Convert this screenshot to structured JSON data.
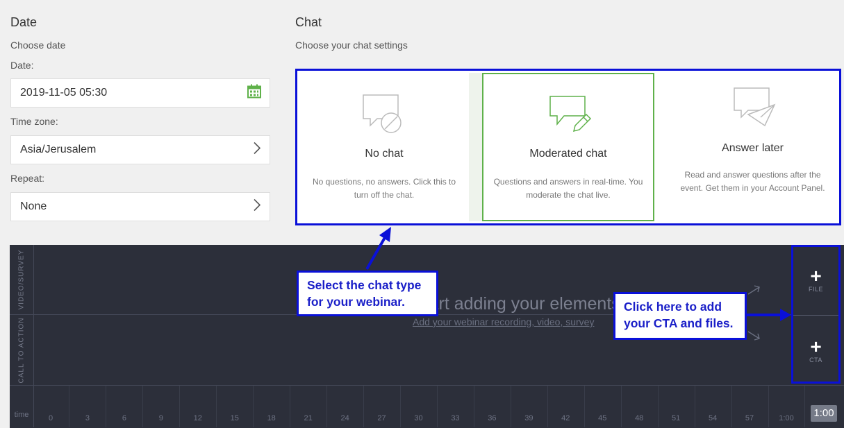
{
  "date_section": {
    "title": "Date",
    "subtitle": "Choose date",
    "date_label": "Date:",
    "date_value": "2019-11-05 05:30",
    "timezone_label": "Time zone:",
    "timezone_value": "Asia/Jerusalem",
    "repeat_label": "Repeat:",
    "repeat_value": "None"
  },
  "chat_section": {
    "title": "Chat",
    "subtitle": "Choose your chat settings",
    "options": [
      {
        "title": "No chat",
        "description": "No questions, no answers. Click this to turn off the chat.",
        "icon": "no-chat-icon",
        "selected": false
      },
      {
        "title": "Moderated chat",
        "description": "Questions and answers in real-time. You moderate the chat live.",
        "icon": "moderated-chat-icon",
        "selected": true
      },
      {
        "title": "Answer later",
        "description": "Read and answer questions after the event. Get them in your Account Panel.",
        "icon": "answer-later-icon",
        "selected": false
      }
    ]
  },
  "timeline": {
    "track_labels": [
      "VIDEO/SURVEY",
      "CALL TO ACTION"
    ],
    "empty_title": "Start adding your elements",
    "empty_link": "Add your webinar recording, video, survey",
    "add_buttons": [
      {
        "label": "FILE",
        "icon": "plus-icon"
      },
      {
        "label": "CTA",
        "icon": "plus-icon"
      }
    ],
    "time_label": "time",
    "ticks": [
      "0",
      "3",
      "6",
      "9",
      "12",
      "15",
      "18",
      "21",
      "24",
      "27",
      "30",
      "33",
      "36",
      "39",
      "42",
      "45",
      "48",
      "51",
      "54",
      "57",
      "1:00"
    ],
    "duration": "1:00"
  },
  "callouts": {
    "chat": "Select the chat  type for your webinar.",
    "cta": "Click here to add your CTA and files."
  },
  "colors": {
    "accent_green": "#5fb14a",
    "annotation_blue": "#0a10d8",
    "timeline_bg": "#2c2f3a"
  }
}
